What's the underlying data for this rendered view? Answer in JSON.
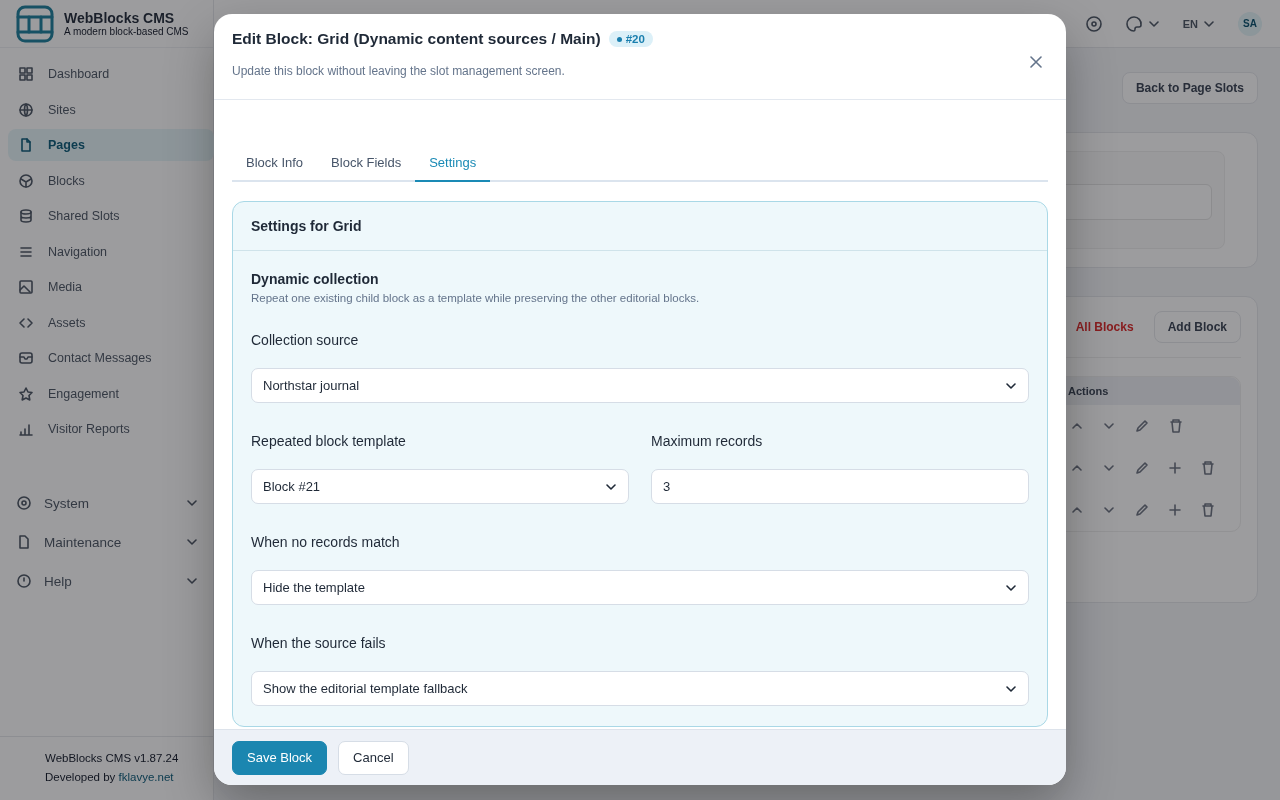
{
  "app": {
    "brand": "WebBlocks CMS",
    "tagline": "A modern block-based CMS",
    "version": "WebBlocks CMS v1.87.24",
    "developed_by": "Developed by",
    "developer_link": "fklavye.net"
  },
  "sidebar": {
    "items": [
      {
        "label": "Dashboard",
        "selected": false
      },
      {
        "label": "Sites",
        "selected": false
      },
      {
        "label": "Pages",
        "selected": true
      },
      {
        "label": "Blocks",
        "selected": false
      },
      {
        "label": "Shared Slots",
        "selected": false
      },
      {
        "label": "Navigation",
        "selected": false
      },
      {
        "label": "Media",
        "selected": false
      },
      {
        "label": "Assets",
        "selected": false
      },
      {
        "label": "Contact Messages",
        "selected": false
      },
      {
        "label": "Engagement",
        "selected": false
      },
      {
        "label": "Visitor Reports",
        "selected": false
      }
    ],
    "groups": [
      {
        "label": "System"
      },
      {
        "label": "Maintenance"
      },
      {
        "label": "Help"
      }
    ]
  },
  "topbar": {
    "language": "EN",
    "avatar": "SA"
  },
  "page": {
    "back_button": "Back to Page Slots",
    "delete_all_link": "All Blocks",
    "add_block_button": "Add Block",
    "table_header": "Actions",
    "rows": [
      {
        "kind": "first"
      },
      {
        "kind": "nested"
      },
      {
        "kind": "nested"
      }
    ]
  },
  "modal": {
    "title": "Edit Block: Grid (Dynamic content sources / Main)",
    "badge": "#20",
    "subtitle": "Update this block without leaving the slot management screen.",
    "tabs": [
      {
        "label": "Block Info",
        "selected": false
      },
      {
        "label": "Block Fields",
        "selected": false
      },
      {
        "label": "Settings",
        "selected": true
      }
    ],
    "card_title": "Settings for Grid",
    "section": {
      "title": "Dynamic collection",
      "description": "Repeat one existing child block as a template while preserving the other editorial blocks."
    },
    "rows": [
      [
        {
          "label": "Collection source",
          "kind": "select",
          "value": "Northstar journal"
        }
      ],
      [
        {
          "label": "Repeated block template",
          "kind": "select",
          "value": "Block #21"
        },
        {
          "label": "Maximum records",
          "kind": "input",
          "value": "3"
        }
      ],
      [
        {
          "label": "When no records match",
          "kind": "select",
          "value": "Hide the template"
        }
      ],
      [
        {
          "label": "When the source fails",
          "kind": "select",
          "value": "Show the editorial template fallback"
        }
      ]
    ],
    "buttons": [
      {
        "label": "Save Block",
        "kind": "primary"
      },
      {
        "label": "Cancel",
        "kind": "secondary"
      }
    ]
  }
}
